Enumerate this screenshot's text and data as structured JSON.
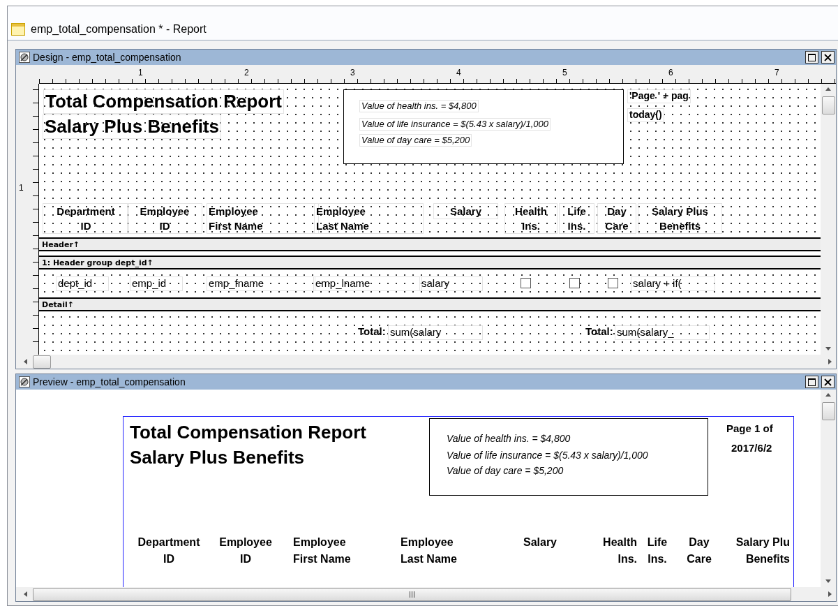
{
  "window": {
    "title": "emp_total_compensation * - Report"
  },
  "design": {
    "title": "Design - emp_total_compensation",
    "ruler_numbers": [
      "1",
      "2",
      "3",
      "4",
      "5",
      "6",
      "7"
    ],
    "vruler_numbers": [
      "1"
    ],
    "report_title": [
      "Total Compensation Report",
      "Salary Plus Benefits"
    ],
    "notes": [
      "Value of health ins. = $4,800",
      "Value of life insurance = $(5.43 x salary)/1,000",
      "Value of day care = $5,200"
    ],
    "page_expr": "'Page ' + pag",
    "date_expr": "today()",
    "columns": [
      {
        "lines": [
          "Department",
          "ID"
        ]
      },
      {
        "lines": [
          "Employee",
          "ID"
        ]
      },
      {
        "lines": [
          "Employee",
          "First Name"
        ]
      },
      {
        "lines": [
          "Employee",
          "Last Name"
        ]
      },
      {
        "lines": [
          "Salary"
        ]
      },
      {
        "lines": [
          "Health",
          "Ins."
        ]
      },
      {
        "lines": [
          "Life",
          "Ins."
        ]
      },
      {
        "lines": [
          "Day",
          "Care"
        ]
      },
      {
        "lines": [
          "Salary Plus",
          "Benefits"
        ]
      }
    ],
    "header_band": "Header↑",
    "group_band": "1: Header group dept_id↑",
    "detail_fields": [
      {
        "kind": "text",
        "text": "dept_id"
      },
      {
        "kind": "text",
        "text": "emp_id"
      },
      {
        "kind": "text",
        "text": "emp_fname"
      },
      {
        "kind": "text",
        "text": "emp_lname"
      },
      {
        "kind": "text",
        "text": "salary"
      },
      {
        "kind": "checkbox",
        "checked": false
      },
      {
        "kind": "checkbox",
        "checked": false
      },
      {
        "kind": "checkbox",
        "checked": false
      },
      {
        "kind": "text",
        "text": "salary + if("
      }
    ],
    "detail_band": "Detail↑",
    "totals": [
      {
        "label": "Total:",
        "expr": "sum(salary"
      },
      {
        "label": "Total:",
        "expr": "sum(salary_"
      }
    ]
  },
  "preview": {
    "title": "Preview - emp_total_compensation",
    "report_title": [
      "Total Compensation Report",
      "Salary Plus Benefits"
    ],
    "notes": [
      "Value of health ins. = $4,800",
      "Value of life insurance = $(5.43 x salary)/1,000",
      "Value of day care = $5,200"
    ],
    "page": "Page 1 of",
    "date": "2017/6/2",
    "columns": [
      {
        "lines": [
          "Department",
          "ID"
        ]
      },
      {
        "lines": [
          "Employee",
          "ID"
        ]
      },
      {
        "lines": [
          "Employee",
          "First Name"
        ]
      },
      {
        "lines": [
          "Employee",
          "Last Name"
        ]
      },
      {
        "lines": [
          "Salary"
        ]
      },
      {
        "lines": [
          "Health",
          "Ins."
        ]
      },
      {
        "lines": [
          "Life",
          "Ins."
        ]
      },
      {
        "lines": [
          "Day",
          "Care"
        ]
      },
      {
        "lines": [
          "Salary Plu",
          "Benefits"
        ]
      }
    ]
  }
}
